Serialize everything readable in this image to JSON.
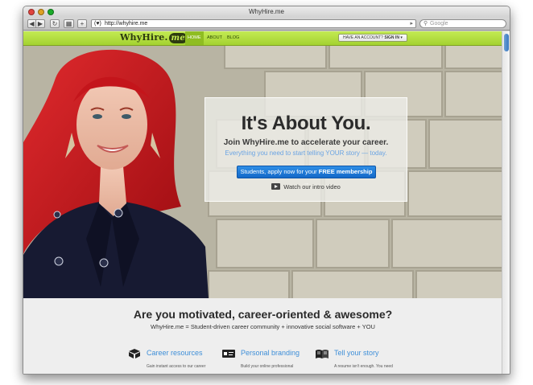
{
  "window": {
    "title": "WhyHire.me"
  },
  "browser": {
    "back_label": "◀",
    "forward_label": "▶",
    "reload_label": "↻",
    "tile_label": "▦",
    "add_label": "+",
    "favicon_text": "(♥)",
    "url": "http://whyhire.me",
    "url_arrow": "▸",
    "search_placeholder": "Google"
  },
  "nav": {
    "logo_text": "WhyHire.",
    "logo_accent": "me",
    "links": [
      "HOME",
      "ABOUT",
      "BLOG"
    ],
    "active": "HOME",
    "account_prompt": "HAVE AN ACCOUNT?",
    "sign_in_label": "SIGN IN",
    "sign_in_caret": "▾"
  },
  "hero": {
    "title": "It's About You.",
    "subtitle": "Join WhyHire.me to accelerate your career.",
    "tagline": "Everything you need to start telling YOUR story — today.",
    "cta_prefix": "Students, apply now for your",
    "cta_bold": "FREE membership",
    "cta_arrow": "→",
    "video_label": "Watch our intro video"
  },
  "section": {
    "title": "Are you motivated, career-oriented & awesome?",
    "subtitle": "WhyHire.me = Student-driven career community + innovative social software + YOU"
  },
  "features": [
    {
      "title": "Career resources",
      "desc": "Gain instant access to our career",
      "icon": "box-icon"
    },
    {
      "title": "Personal branding",
      "desc": "Build your online professional",
      "icon": "id-card-icon"
    },
    {
      "title": "Tell your story",
      "desc": "A resume isn't enough. You need",
      "icon": "open-book-icon"
    }
  ],
  "colors": {
    "nav_green": "#b3df42",
    "cta_blue": "#1a74d1",
    "link_blue": "#3f8fd8",
    "hair_red": "#c4151b",
    "coat_navy": "#171a32"
  }
}
